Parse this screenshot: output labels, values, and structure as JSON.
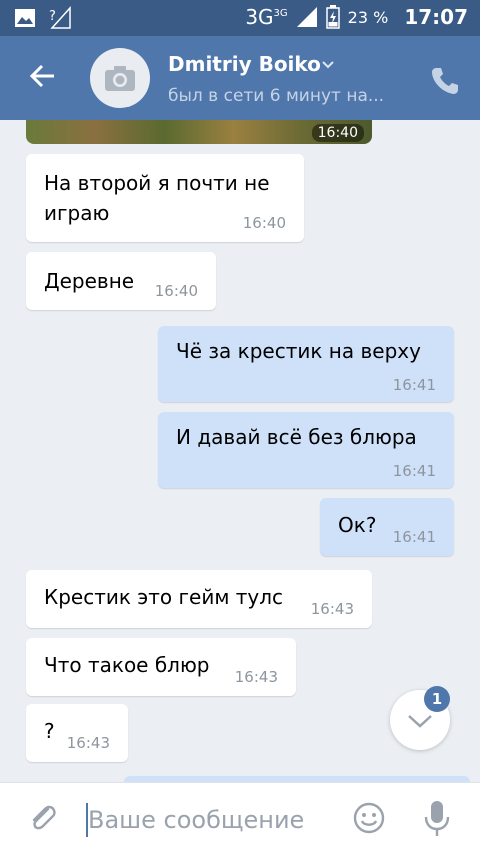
{
  "statusbar": {
    "network": "3G",
    "network_small": "3G",
    "battery_percent": "23 %",
    "time": "17:07"
  },
  "header": {
    "contact_name": "Dmitriy Boiko",
    "contact_status": "был в сети 6 минут на..."
  },
  "image_message": {
    "time": "16:40"
  },
  "messages": [
    {
      "direction": "in",
      "lines": [
        "На второй я почти не",
        "играю"
      ],
      "time": "16:40"
    },
    {
      "direction": "in",
      "lines": [
        "Деревне"
      ],
      "time": "16:40"
    },
    {
      "direction": "out",
      "lines": [
        "Чё за крестик на верху"
      ],
      "time": "16:41"
    },
    {
      "direction": "out",
      "lines": [
        "И давай всё без блюра"
      ],
      "time": "16:41"
    },
    {
      "direction": "out",
      "lines": [
        "Ок?"
      ],
      "time": "16:41"
    },
    {
      "direction": "in",
      "lines": [
        "Крестик это гейм тулс"
      ],
      "time": "16:43"
    },
    {
      "direction": "in",
      "lines": [
        "Что такое блюр"
      ],
      "time": "16:43"
    },
    {
      "direction": "in",
      "lines": [
        "?"
      ],
      "time": "16:43"
    }
  ],
  "scroll_down": {
    "badge_count": "1"
  },
  "composer": {
    "placeholder": "Ваше сообщение"
  },
  "icons": {
    "back": "arrow-left-icon",
    "avatar": "camera-icon",
    "call": "phone-icon",
    "attach": "paperclip-icon",
    "emoji": "smiley-icon",
    "mic": "microphone-icon"
  },
  "colors": {
    "header": "#4f77ab",
    "statusbar": "#3a5b86",
    "outgoing_bubble": "#cfe1f9",
    "incoming_bubble": "#ffffff",
    "background": "#ebeef2"
  }
}
